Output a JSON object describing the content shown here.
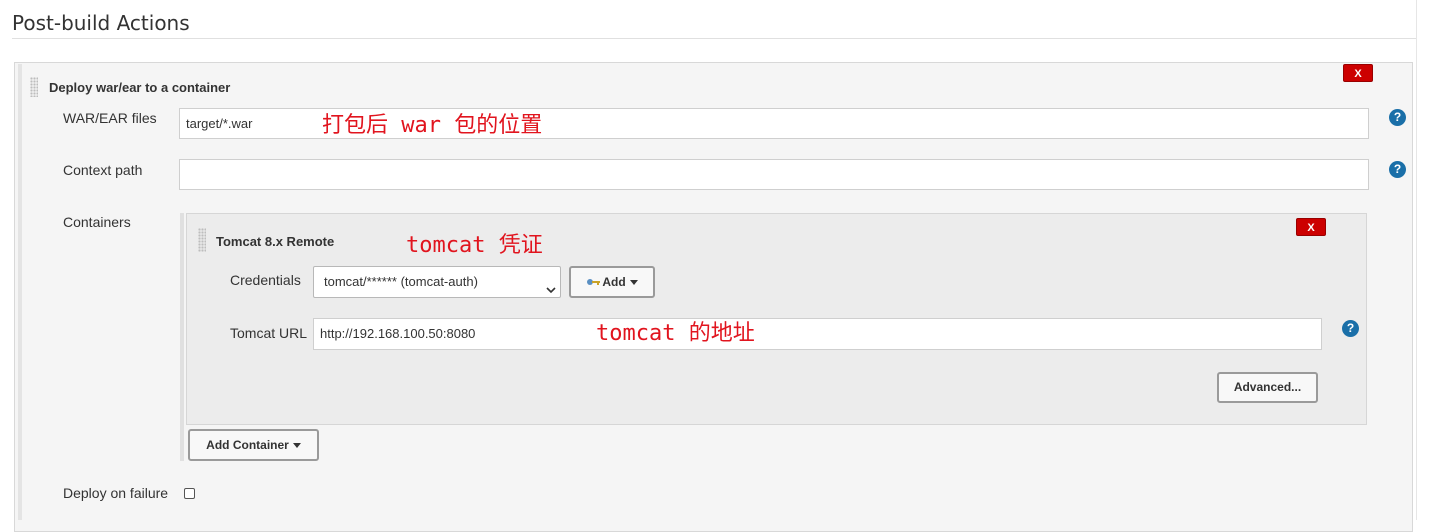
{
  "section": {
    "title": "Post-build Actions"
  },
  "deploy_block": {
    "title": "Deploy war/ear to a container",
    "delete_label": "X",
    "war_files": {
      "label": "WAR/EAR files",
      "value": "target/*.war",
      "annotation": "打包后 war 包的位置"
    },
    "context_path": {
      "label": "Context path",
      "value": ""
    },
    "containers": {
      "label": "Containers",
      "tomcat": {
        "title": "Tomcat 8.x Remote",
        "annotation": "tomcat 凭证",
        "delete_label": "X",
        "credentials": {
          "label": "Credentials",
          "value": "tomcat/****** (tomcat-auth)",
          "add_label": "Add"
        },
        "url": {
          "label": "Tomcat URL",
          "value": "http://192.168.100.50:8080",
          "annotation": "tomcat 的地址"
        },
        "advanced_label": "Advanced..."
      },
      "add_container_label": "Add Container"
    },
    "deploy_on_failure": {
      "label": "Deploy on failure",
      "checked": false
    }
  },
  "help_label": "?"
}
